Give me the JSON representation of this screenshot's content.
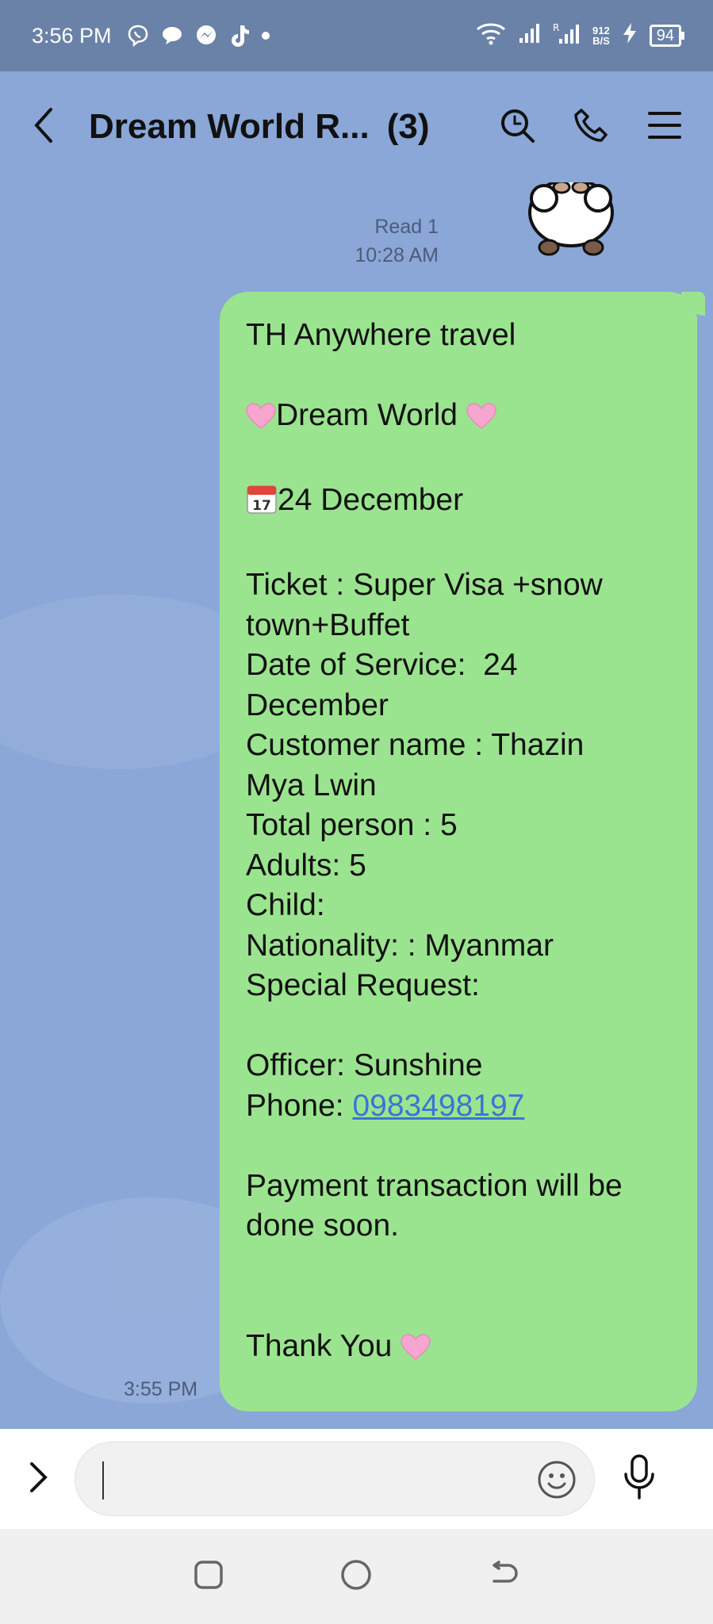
{
  "status_bar": {
    "time": "3:56 PM",
    "net_speed_value": "912",
    "net_speed_unit": "B/S",
    "battery": "94",
    "icons": [
      "viber-icon",
      "chat-bubble-icon",
      "messenger-icon",
      "tiktok-icon",
      "dot-icon",
      "wifi-icon",
      "signal-icon",
      "roaming-signal-icon",
      "charging-icon",
      "battery-icon"
    ]
  },
  "header": {
    "title": "Dream World R...",
    "count": "(3)",
    "icons": [
      "back-arrow-icon",
      "search-icon",
      "phone-icon",
      "menu-icon"
    ]
  },
  "chat": {
    "read_label": "Read 1",
    "read_time": "10:28 AM",
    "sent_time": "3:55 PM",
    "message": {
      "line1": "TH Anywhere travel",
      "line2_text": "Dream World ",
      "line3_text": "24 December",
      "line4": "Ticket : Super Visa +snow",
      "line5": "town+Buffet",
      "line6": "Date of Service:  24",
      "line7": "December",
      "line8": "Customer name : Thazin",
      "line9": "Mya Lwin",
      "line10": "Total person : 5",
      "line11": "Adults: 5",
      "line12": "Child:",
      "line13": "Nationality: : Myanmar",
      "line14": "Special Request:",
      "line15": "Officer: Sunshine",
      "phone_label": "Phone: ",
      "phone_number": "0983498197",
      "line17": "Payment transaction will be",
      "line18": "done soon.",
      "line19_text": "Thank You "
    },
    "colors": {
      "bubble": "#9be48f",
      "background": "#8aa7d8",
      "link": "#3b74d8"
    }
  },
  "input_bar": {
    "icons": [
      "expand-chevron-icon",
      "emoji-icon",
      "microphone-icon"
    ]
  },
  "nav_bar": {
    "icons": [
      "recents-square-icon",
      "home-circle-icon",
      "back-nav-icon"
    ]
  }
}
